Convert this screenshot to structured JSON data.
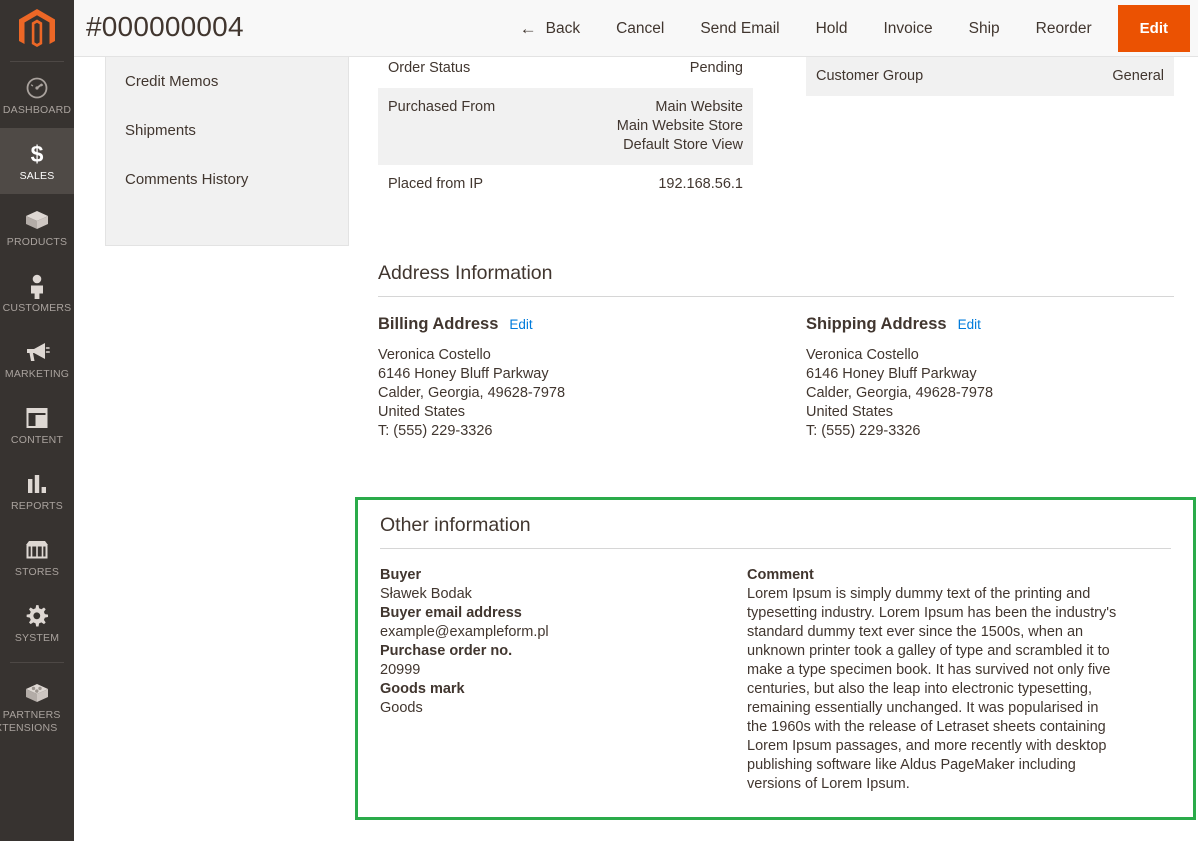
{
  "sidebar": {
    "logo": "magento-logo",
    "items": [
      {
        "label": "DASHBOARD",
        "icon": "dashboard-icon",
        "active": false
      },
      {
        "label": "SALES",
        "icon": "dollar-icon",
        "active": true
      },
      {
        "label": "PRODUCTS",
        "icon": "box-icon",
        "active": false
      },
      {
        "label": "CUSTOMERS",
        "icon": "person-icon",
        "active": false
      },
      {
        "label": "MARKETING",
        "icon": "megaphone-icon",
        "active": false
      },
      {
        "label": "CONTENT",
        "icon": "layout-icon",
        "active": false
      },
      {
        "label": "REPORTS",
        "icon": "bar-chart-icon",
        "active": false
      },
      {
        "label": "STORES",
        "icon": "storefront-icon",
        "active": false
      },
      {
        "label": "SYSTEM",
        "icon": "gear-icon",
        "active": false
      }
    ],
    "partners": {
      "line1": "FIND PARTNERS",
      "line2": "& EXTENSIONS",
      "icon": "puzzle-block-icon"
    }
  },
  "header": {
    "title": "#000000004",
    "buttons": [
      {
        "label": "Back",
        "icon": "arrow-left-icon",
        "primary": false
      },
      {
        "label": "Cancel",
        "primary": false
      },
      {
        "label": "Send Email",
        "primary": false
      },
      {
        "label": "Hold",
        "primary": false
      },
      {
        "label": "Invoice",
        "primary": false
      },
      {
        "label": "Ship",
        "primary": false
      },
      {
        "label": "Reorder",
        "primary": false
      },
      {
        "label": "Edit",
        "primary": true
      }
    ]
  },
  "sub_nav": {
    "items": [
      {
        "label": "Credit Memos"
      },
      {
        "label": "Shipments"
      },
      {
        "label": "Comments History"
      }
    ]
  },
  "order_info": {
    "rows": [
      {
        "key": "Order Status",
        "value": "Pending",
        "shaded": false
      },
      {
        "key": "Purchased From",
        "value": "Main Website\nMain Website Store\nDefault Store View",
        "shaded": true
      },
      {
        "key": "Placed from IP",
        "value": "192.168.56.1",
        "shaded": false
      }
    ]
  },
  "customer_info": {
    "rows": [
      {
        "key": "Customer Group",
        "value": "General",
        "shaded": true
      }
    ]
  },
  "address_information": {
    "title": "Address Information",
    "billing": {
      "heading": "Billing Address",
      "edit_label": "Edit",
      "name": "Veronica Costello",
      "street": "6146 Honey Bluff Parkway",
      "city_state_zip": "Calder, Georgia, 49628-7978",
      "country": "United States",
      "phone": "T: (555) 229-3326"
    },
    "shipping": {
      "heading": "Shipping Address",
      "edit_label": "Edit",
      "name": "Veronica Costello",
      "street": "6146 Honey Bluff Parkway",
      "city_state_zip": "Calder, Georgia, 49628-7978",
      "country": "United States",
      "phone": "T: (555) 229-3326"
    }
  },
  "other_information": {
    "title": "Other information",
    "highlight_color": "#2aab4a",
    "fields": [
      {
        "label": "Buyer",
        "value": "Sławek Bodak"
      },
      {
        "label": "Buyer email address",
        "value": "example@exampleform.pl"
      },
      {
        "label": "Purchase order no.",
        "value": "20999"
      },
      {
        "label": "Goods mark",
        "value": "Goods"
      }
    ],
    "comment_label": "Comment",
    "comment_text": "Lorem Ipsum is simply dummy text of the printing and typesetting industry. Lorem Ipsum has been the industry's standard dummy text ever since the 1500s, when an unknown printer took a galley of type and scrambled it to make a type specimen book. It has survived not only five centuries, but also the leap into electronic typesetting, remaining essentially unchanged. It was popularised in the 1960s with the release of Letraset sheets containing Lorem Ipsum passages, and more recently with desktop publishing software like Aldus PageMaker including versions of Lorem Ipsum."
  },
  "colors": {
    "sidebar_bg": "#373330",
    "sidebar_active": "#4f4a46",
    "brand_orange": "#eb5202",
    "link_blue": "#007bdb",
    "highlight_green": "#2aab4a",
    "text": "#41362f",
    "row_shade": "#f1f1f1"
  }
}
